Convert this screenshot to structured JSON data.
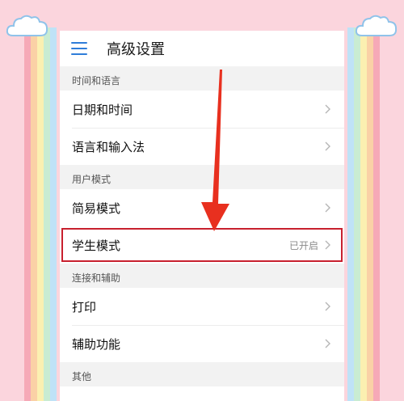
{
  "header": {
    "title": "高级设置"
  },
  "sections": [
    {
      "header": "时间和语言",
      "items": [
        {
          "label": "日期和时间",
          "status": ""
        },
        {
          "label": "语言和输入法",
          "status": ""
        }
      ]
    },
    {
      "header": "用户模式",
      "items": [
        {
          "label": "简易模式",
          "status": ""
        },
        {
          "label": "学生模式",
          "status": "已开启"
        }
      ]
    },
    {
      "header": "连接和辅助",
      "items": [
        {
          "label": "打印",
          "status": ""
        },
        {
          "label": "辅助功能",
          "status": ""
        }
      ]
    },
    {
      "header": "其他",
      "items": []
    }
  ],
  "colors": {
    "accent": "#2f7dd9",
    "highlight": "#c8202e",
    "arrow": "#e8301f",
    "background": "#fbd5dd"
  },
  "icons": [
    "menu-icon",
    "chevron-right-icon",
    "cloud-icon"
  ]
}
